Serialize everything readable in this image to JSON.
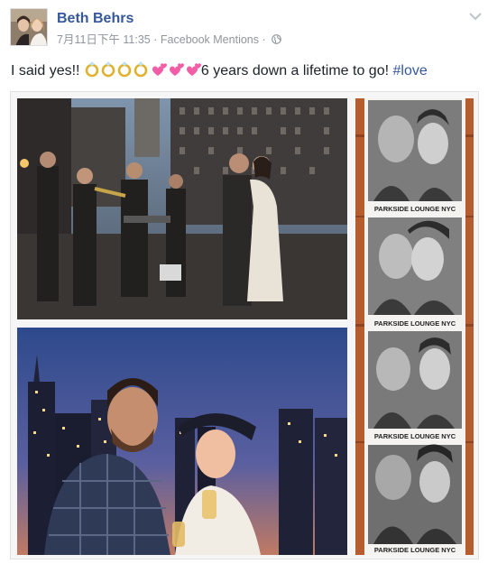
{
  "post": {
    "author": "Beth Behrs",
    "timestamp": "7月11日下午 11:35",
    "separator": "·",
    "source": "Facebook Mentions",
    "privacy_icon": "globe-icon",
    "menu_icon": "chevron-down-icon",
    "text_before": "I said yes!! ",
    "text_after": "6 years down a lifetime to go! ",
    "hashtag": "#love",
    "emoji": [
      "ring-emoji",
      "ring-emoji",
      "ring-emoji",
      "ring-emoji",
      "two-hearts-emoji",
      "two-hearts-emoji",
      "two-hearts-emoji"
    ]
  },
  "photos": {
    "strip_captions": [
      "PARKSIDE LOUNGE NYC",
      "PARKSIDE LOUNGE NYC",
      "PARKSIDE LOUNGE NYC",
      "PARKSIDE LOUNGE NYC"
    ]
  },
  "colors": {
    "link": "#365899",
    "meta": "#90949c",
    "text": "#1d2129"
  }
}
